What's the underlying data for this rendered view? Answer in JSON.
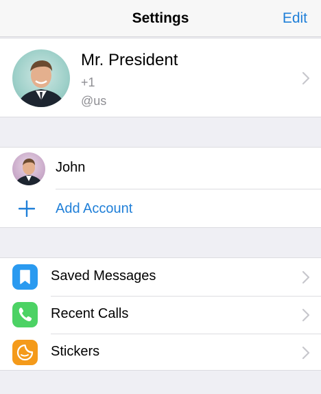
{
  "navbar": {
    "title": "Settings",
    "edit_label": "Edit"
  },
  "profile": {
    "name": "Mr. President",
    "phone": "+1",
    "username": "@us"
  },
  "accounts": {
    "items": [
      {
        "name": "John"
      }
    ],
    "add_label": "Add Account"
  },
  "menu": {
    "items": [
      {
        "label": "Saved Messages",
        "icon": "bookmark-icon",
        "color": "#2a9af0"
      },
      {
        "label": "Recent Calls",
        "icon": "phone-icon",
        "color": "#4cd264"
      },
      {
        "label": "Stickers",
        "icon": "sticker-icon",
        "color": "#f49a1a"
      }
    ]
  },
  "colors": {
    "accent": "#1f7fd8",
    "background": "#efeff4",
    "secondary_text": "#8e8e93"
  }
}
